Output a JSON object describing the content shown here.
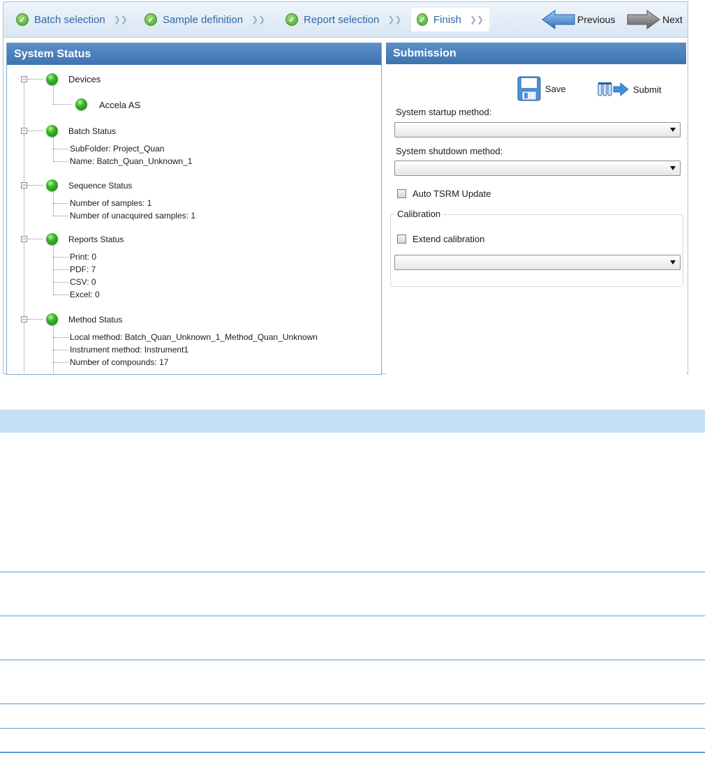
{
  "wizard": {
    "steps": [
      {
        "label": "Batch selection"
      },
      {
        "label": "Sample definition"
      },
      {
        "label": "Report selection"
      },
      {
        "label": "Finish"
      }
    ],
    "previous_label": "Previous",
    "next_label": "Next"
  },
  "system_status": {
    "title": "System Status",
    "devices": {
      "label": "Devices",
      "items": [
        "Accela AS"
      ]
    },
    "batch": {
      "label": "Batch Status",
      "items": [
        "SubFolder:  Project_Quan",
        "Name: Batch_Quan_Unknown_1"
      ]
    },
    "sequence": {
      "label": "Sequence Status",
      "items": [
        "Number of samples: 1",
        "Number of unacquired samples: 1"
      ]
    },
    "reports": {
      "label": "Reports Status",
      "items": [
        "Print: 0",
        "PDF: 7",
        "CSV: 0",
        "Excel: 0"
      ]
    },
    "method": {
      "label": "Method Status",
      "items": [
        "Local method: Batch_Quan_Unknown_1_Method_Quan_Unknown",
        "Instrument method: Instrument1",
        "Number of compounds: 17"
      ]
    }
  },
  "submission": {
    "title": "Submission",
    "save_label": "Save",
    "submit_label": "Submit",
    "startup_label": "System startup method:",
    "startup_value": "",
    "shutdown_label": "System shutdown method:",
    "shutdown_value": "",
    "auto_tsrm_label": "Auto TSRM Update",
    "calibration_legend": "Calibration",
    "extend_calibration_label": "Extend calibration",
    "calibration_value": ""
  },
  "colors": {
    "panel_header": "#3e73b0",
    "wizard_text": "#2f6aa6",
    "status_led": "#3cb82a",
    "table_header": "#c6e0f6",
    "table_rule": "#5b9bd5"
  }
}
